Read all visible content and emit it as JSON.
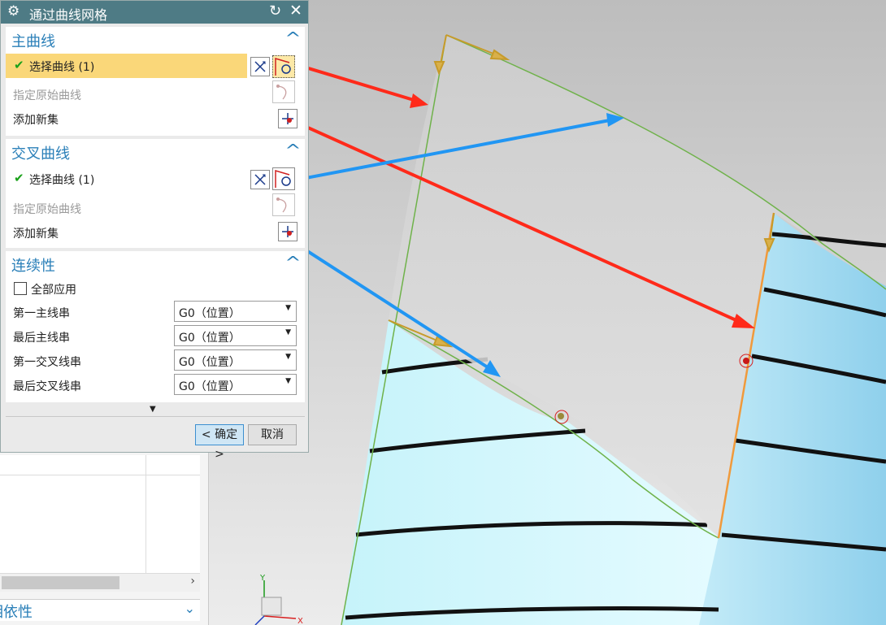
{
  "dialog": {
    "title": "通过曲线网格",
    "icons": {
      "settings": "gear-icon",
      "reset": "reset-icon",
      "close": "close-icon"
    }
  },
  "primary_curves": {
    "title": "主曲线",
    "select_label": "选择曲线 (1)",
    "specify_origin_label": "指定原始曲线",
    "add_new_set_label": "添加新集"
  },
  "cross_curves": {
    "title": "交叉曲线",
    "select_label": "选择曲线 (1)",
    "specify_origin_label": "指定原始曲线",
    "add_new_set_label": "添加新集"
  },
  "continuity": {
    "title": "连续性",
    "apply_all_label": "全部应用",
    "apply_all_checked": false,
    "rows": [
      {
        "label": "第一主线串",
        "value": "G0（位置）"
      },
      {
        "label": "最后主线串",
        "value": "G0（位置）"
      },
      {
        "label": "第一交叉线串",
        "value": "G0（位置）"
      },
      {
        "label": "最后交叉线串",
        "value": "G0（位置）"
      }
    ]
  },
  "buttons": {
    "ok": "< 确定 >",
    "cancel": "取消"
  },
  "navigator": {
    "section_label": "相依性"
  },
  "axes": {
    "x": "X",
    "y": "Y"
  },
  "colors": {
    "title_bar": "#4e7b85",
    "section_title": "#2a7fb8",
    "selection_highlight": "#fad779",
    "annotation_red": "#ff2a1a",
    "annotation_blue": "#2196f3",
    "surface_cyan": "#ccf4fa",
    "mesh_green": "#6fb24a",
    "edge_orange": "#f09a3c"
  }
}
